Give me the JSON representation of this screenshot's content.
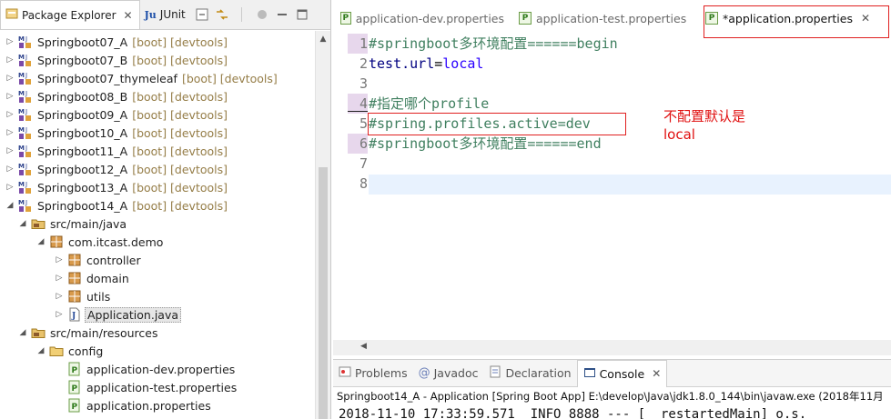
{
  "left_tabs": {
    "package_explorer": "Package Explorer",
    "junit": "JUnit"
  },
  "tree": [
    {
      "name": "Springboot07_A",
      "decoration": "[boot] [devtools]",
      "icon": "maven-project-icon",
      "depth": 0,
      "expanded": false
    },
    {
      "name": "Springboot07_B",
      "decoration": "[boot] [devtools]",
      "icon": "maven-project-icon",
      "depth": 0,
      "expanded": false
    },
    {
      "name": "Springboot07_thymeleaf",
      "decoration": "[boot] [devtools]",
      "icon": "maven-project-icon",
      "depth": 0,
      "expanded": false
    },
    {
      "name": "Springboot08_B",
      "decoration": "[boot] [devtools]",
      "icon": "maven-project-icon",
      "depth": 0,
      "expanded": false
    },
    {
      "name": "Springboot09_A",
      "decoration": "[boot] [devtools]",
      "icon": "maven-project-icon",
      "depth": 0,
      "expanded": false
    },
    {
      "name": "Springboot10_A",
      "decoration": "[boot] [devtools]",
      "icon": "maven-project-icon",
      "depth": 0,
      "expanded": false
    },
    {
      "name": "Springboot11_A",
      "decoration": "[boot] [devtools]",
      "icon": "maven-project-icon",
      "depth": 0,
      "expanded": false
    },
    {
      "name": "Springboot12_A",
      "decoration": "[boot] [devtools]",
      "icon": "maven-project-icon",
      "depth": 0,
      "expanded": false
    },
    {
      "name": "Springboot13_A",
      "decoration": "[boot] [devtools]",
      "icon": "maven-project-icon",
      "depth": 0,
      "expanded": false
    },
    {
      "name": "Springboot14_A",
      "decoration": "[boot] [devtools]",
      "icon": "maven-project-icon",
      "depth": 0,
      "expanded": true
    },
    {
      "name": "src/main/java",
      "decoration": "",
      "icon": "source-folder-icon",
      "depth": 1,
      "expanded": true
    },
    {
      "name": "com.itcast.demo",
      "decoration": "",
      "icon": "package-icon",
      "depth": 2,
      "expanded": true
    },
    {
      "name": "controller",
      "decoration": "",
      "icon": "package-icon",
      "depth": 3,
      "expanded": false
    },
    {
      "name": "domain",
      "decoration": "",
      "icon": "package-icon",
      "depth": 3,
      "expanded": false
    },
    {
      "name": "utils",
      "decoration": "",
      "icon": "package-icon",
      "depth": 3,
      "expanded": false
    },
    {
      "name": "Application.java",
      "decoration": "",
      "icon": "java-file-icon",
      "depth": 3,
      "expanded": false,
      "selected": true
    },
    {
      "name": "src/main/resources",
      "decoration": "",
      "icon": "source-folder-icon",
      "depth": 1,
      "expanded": true
    },
    {
      "name": "config",
      "decoration": "",
      "icon": "folder-icon",
      "depth": 2,
      "expanded": true
    },
    {
      "name": "application-dev.properties",
      "decoration": "",
      "icon": "properties-file-icon",
      "depth": 3,
      "leaf": true
    },
    {
      "name": "application-test.properties",
      "decoration": "",
      "icon": "properties-file-icon",
      "depth": 3,
      "leaf": true
    },
    {
      "name": "application.properties",
      "decoration": "",
      "icon": "properties-file-icon",
      "depth": 3,
      "leaf": true
    }
  ],
  "editor_tabs": [
    {
      "label": "application-dev.properties",
      "active": false
    },
    {
      "label": "application-test.properties",
      "active": false
    },
    {
      "label": "*application.properties",
      "active": true
    }
  ],
  "code_lines": [
    {
      "num": "1",
      "text": "#springboot多环境配置======begin",
      "kind": "comment"
    },
    {
      "num": "2",
      "key": "test.url",
      "eq": "=",
      "value": "local",
      "kind": "prop"
    },
    {
      "num": "3",
      "text": "",
      "kind": "empty"
    },
    {
      "num": "4",
      "text": "#指定哪个profile",
      "kind": "comment"
    },
    {
      "num": "5",
      "text": "#spring.profiles.active=dev",
      "kind": "comment"
    },
    {
      "num": "6",
      "text": "#springboot多环境配置======end",
      "kind": "comment"
    },
    {
      "num": "7",
      "text": "",
      "kind": "empty"
    },
    {
      "num": "8",
      "text": "",
      "kind": "empty"
    }
  ],
  "annotation": {
    "line1": "不配置默认是",
    "line2": "local"
  },
  "console_tabs": [
    {
      "label": "Problems",
      "icon": "problems-icon",
      "active": false
    },
    {
      "label": "Javadoc",
      "icon": "javadoc-icon",
      "active": false
    },
    {
      "label": "Declaration",
      "icon": "declaration-icon",
      "active": false
    },
    {
      "label": "Console",
      "icon": "console-icon",
      "active": true
    }
  ],
  "console": {
    "launch_info": "Springboot14_A - Application [Spring Boot App] E:\\develop\\Java\\jdk1.8.0_144\\bin\\javaw.exe (2018年11月",
    "log_line": "2018-11-10 17:33:59.571  INFO 8888 --- [  restartedMain] o.s."
  },
  "colors": {
    "highlight_box": "#e02020",
    "comment": "#3f7f5f",
    "value": "#2a00ff",
    "key": "#000080"
  }
}
